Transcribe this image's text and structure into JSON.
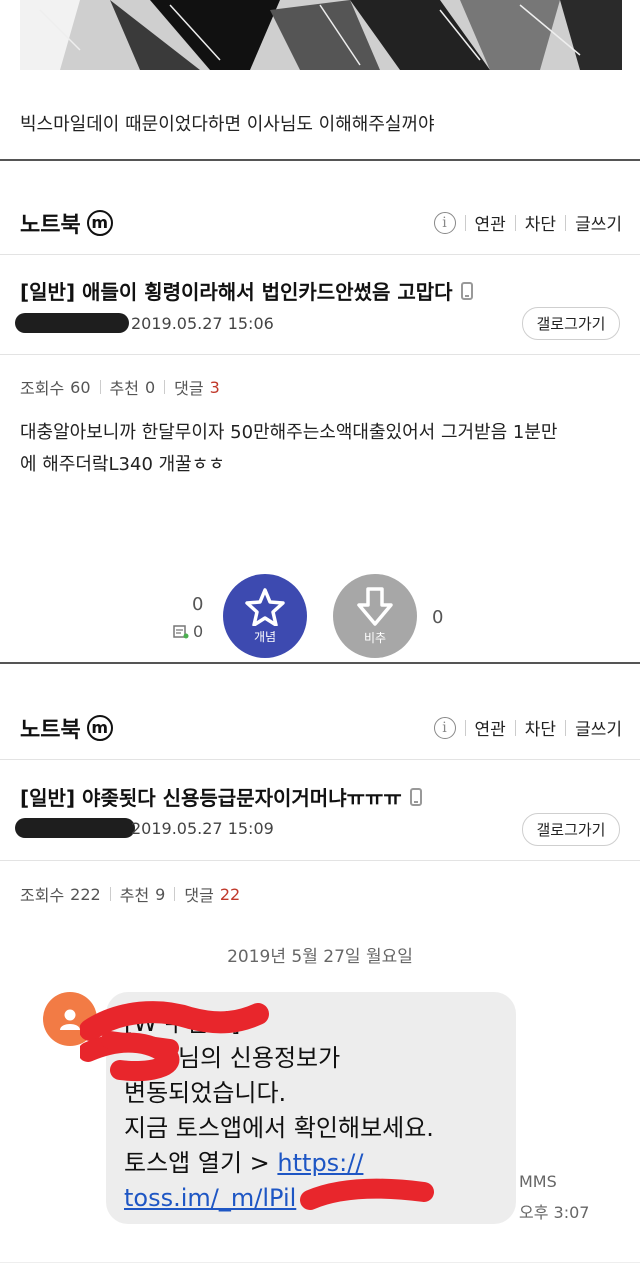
{
  "caption": "빅스마일데이 때문이었다하면 이사님도 이해해주실꺼야",
  "posts": [
    {
      "gallery_name": "노트북",
      "gallery_badge": "m",
      "menu": {
        "info": "i",
        "related": "연관",
        "block": "차단",
        "write": "글쓰기"
      },
      "title": "[일반] 애들이 횡령이라해서 법인카드안썼음 고맙다",
      "date": "2019.05.27 15:06",
      "gallery_button": "갤로그가기",
      "stats": {
        "views_label": "조회수",
        "views": "60",
        "recommend_label": "추천",
        "recommend": "0",
        "comments_label": "댓글",
        "comments": "3"
      },
      "body_lines": [
        "대충알아보니까 한달무이자 50만해주는소액대출있어서 그거받음 1분만",
        "에 해주더랔L340 개꿀ㅎㅎ"
      ],
      "votes": {
        "up_count": "0",
        "fixed_count": "0",
        "up_label": "개념",
        "down_label": "비추",
        "down_count": "0"
      }
    },
    {
      "gallery_name": "노트북",
      "gallery_badge": "m",
      "menu": {
        "info": "i",
        "related": "연관",
        "block": "차단",
        "write": "글쓰기"
      },
      "title": "[일반] 야좆됫다 신용등급문자이거머냐ㅠㅠㅠ",
      "date": "2019.05.27 15:09",
      "gallery_button": "갤로그가기",
      "stats": {
        "views_label": "조회수",
        "views": "222",
        "recommend_label": "추천",
        "recommend": "9",
        "comments_label": "댓글",
        "comments": "22"
      },
      "sms": {
        "date": "2019년 5월 27일 월요일",
        "lines": [
          "[W 수발신]",
          "님의 신용정보가",
          "변동되었습니다.",
          "지금 토스앱에서 확인해보세요.",
          "토스앱 열기 > "
        ],
        "link_1": "https://",
        "link_2": "toss.im/_m/lPil",
        "type": "MMS",
        "time": "오후 3:07"
      }
    }
  ],
  "colors": {
    "vote_up": "#3d4ab0",
    "vote_down": "#a7a7a7",
    "comment_count": "#c0392b",
    "avatar": "#f27b45",
    "link": "#1e56c4",
    "redaction": "#e8262c"
  }
}
